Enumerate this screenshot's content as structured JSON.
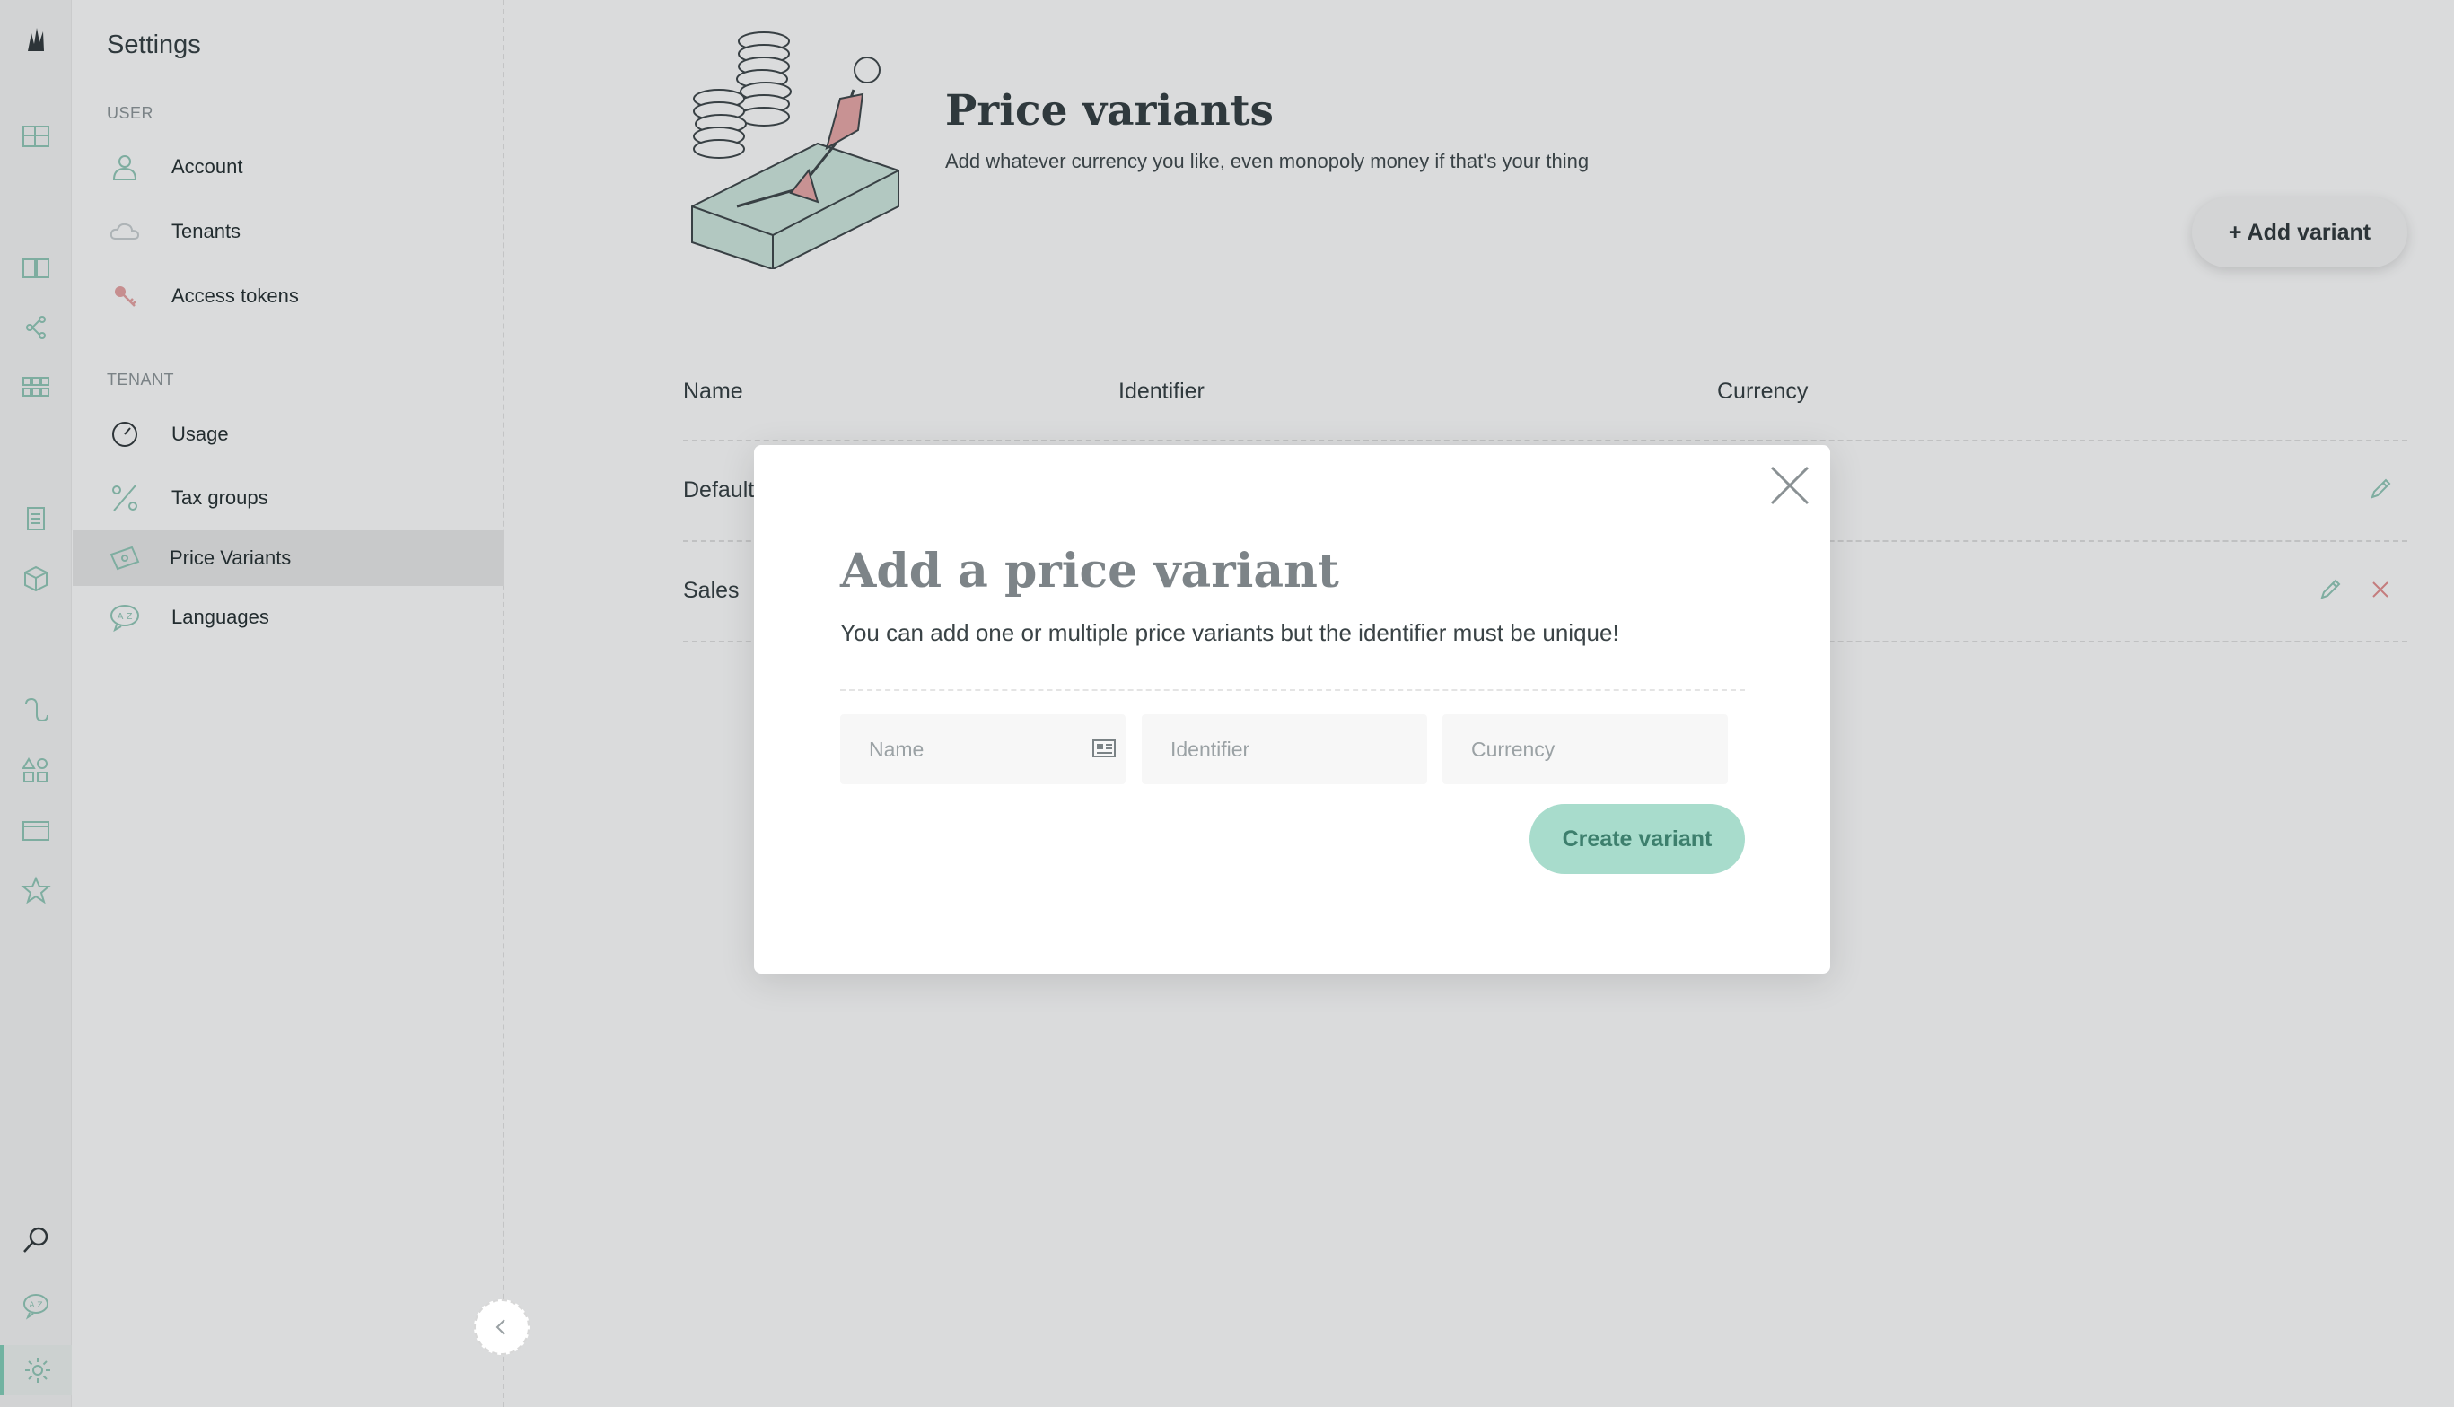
{
  "settings": {
    "title": "Settings",
    "groups": {
      "user": "USER",
      "tenant": "TENANT"
    },
    "items": [
      {
        "label": "Account",
        "icon": "user-icon"
      },
      {
        "label": "Tenants",
        "icon": "cloud-icon"
      },
      {
        "label": "Access tokens",
        "icon": "key-icon"
      },
      {
        "label": "Usage",
        "icon": "gauge-icon"
      },
      {
        "label": "Tax groups",
        "icon": "percent-icon"
      },
      {
        "label": "Price Variants",
        "icon": "price-tag-icon",
        "active": true
      },
      {
        "label": "Languages",
        "icon": "language-bubble-icon"
      }
    ]
  },
  "page": {
    "title": "Price variants",
    "subtitle": "Add whatever currency you like, even monopoly money if that's your thing",
    "add_button": "+ Add variant"
  },
  "table": {
    "columns": [
      "Name",
      "Identifier",
      "Currency"
    ],
    "rows": [
      {
        "name": "Default"
      },
      {
        "name": "Sales"
      }
    ]
  },
  "modal": {
    "title": "Add a price variant",
    "description": "You can add one or multiple price variants but the identifier must be unique!",
    "fields": {
      "name_placeholder": "Name",
      "identifier_placeholder": "Identifier",
      "currency_placeholder": "Currency"
    },
    "submit_label": "Create variant"
  },
  "colors": {
    "accent": "#7fcfb7",
    "button_disabled_bg": "#a8dccc",
    "button_disabled_text": "#3d7f6d",
    "danger": "#e58b8b"
  }
}
